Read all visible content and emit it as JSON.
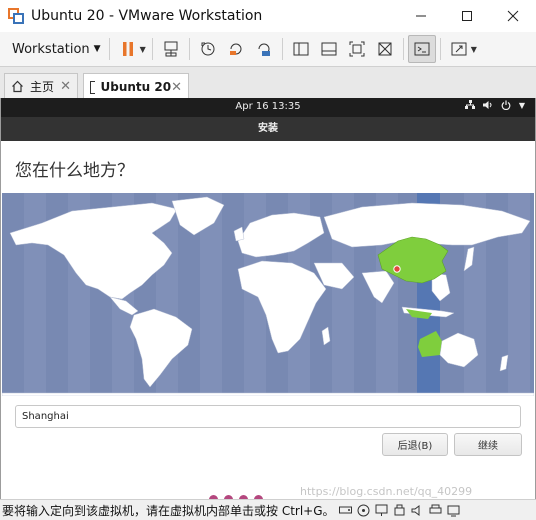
{
  "window": {
    "title": "Ubuntu 20 - VMware Workstation"
  },
  "toolbar": {
    "menu_label": "Workstation"
  },
  "tabs": [
    {
      "label": "主页"
    },
    {
      "label": "Ubuntu 20"
    }
  ],
  "guest": {
    "clock": "Apr 16  13:35",
    "installer_title": "安装",
    "heading": "您在什么地方？",
    "location_value": "Shanghai",
    "back_button": "后退(B)",
    "next_button": "继续"
  },
  "map": {
    "selected_timezone_region": "China",
    "colors": {
      "ocean": "#7889b2",
      "land": "#ffffff",
      "selected_band": "#5577b3",
      "selected_country": "#7fce3d",
      "marker": "#e0493c"
    }
  },
  "status": {
    "message": "要将输入定向到该虚拟机，请在虚拟机内部单击或按 Ctrl+G。",
    "watermark": "https://blog.csdn.net/qq_40299"
  },
  "colors": {
    "pause_orange": "#e8762b",
    "accent_blue": "#3a73b8",
    "tab_play_green": "#35a34c"
  }
}
